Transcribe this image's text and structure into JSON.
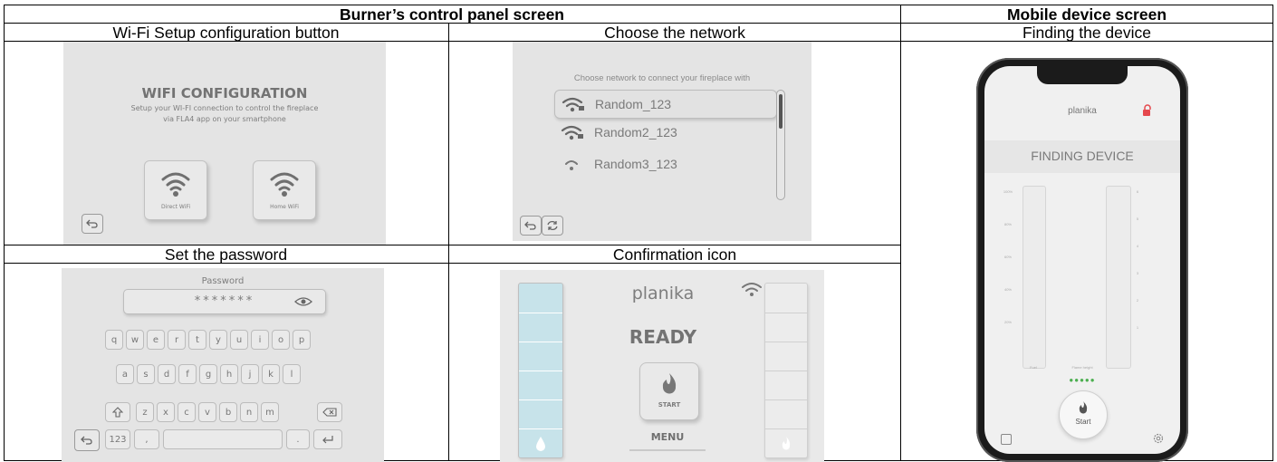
{
  "headers": {
    "burner": "Burner’s control panel screen",
    "mobile": "Mobile device screen"
  },
  "captions": {
    "wifi_setup": "Wi-Fi Setup configuration button",
    "choose_network": "Choose the network",
    "finding_device": "Finding the device",
    "set_password": "Set the password",
    "confirmation": "Confirmation icon"
  },
  "wifi_config": {
    "title": "WIFI CONFIGURATION",
    "line1": "Setup your WI-FI connection to control the fireplace",
    "line2": "via FLA4 app on your smartphone",
    "direct_label": "Direct WiFi",
    "home_label": "Home WiFi"
  },
  "network": {
    "prompt": "Choose network to connect your fireplace with",
    "items": [
      "Random_123",
      "Random2_123",
      "Random3_123"
    ]
  },
  "password": {
    "label": "Password",
    "masked": "*******",
    "rows": [
      [
        "q",
        "w",
        "e",
        "r",
        "t",
        "y",
        "u",
        "i",
        "o",
        "p"
      ],
      [
        "a",
        "s",
        "d",
        "f",
        "g",
        "h",
        "j",
        "k",
        "l"
      ],
      [
        "z",
        "x",
        "c",
        "v",
        "b",
        "n",
        "m"
      ]
    ],
    "numbers_key": "123",
    "comma_key": ",",
    "period_key": "."
  },
  "ready": {
    "brand": "planika",
    "status": "READY",
    "start_label": "START",
    "menu_label": "MENU"
  },
  "phone": {
    "brand": "planika",
    "status": "FINDING DEVICE",
    "start_label": "Start",
    "gauge_left": [
      "100%",
      "80%",
      "60%",
      "40%",
      "20%"
    ],
    "gauge_right": [
      "6",
      "5",
      "4",
      "3",
      "2",
      "1"
    ],
    "label_left": "Fuel",
    "label_right": "Flame height"
  },
  "colors": {
    "panel_bg": "#e4e4e4",
    "fuel_fill": "#c7e3ea",
    "lock_red": "#e5484d",
    "dots_green": "#4caf50"
  }
}
